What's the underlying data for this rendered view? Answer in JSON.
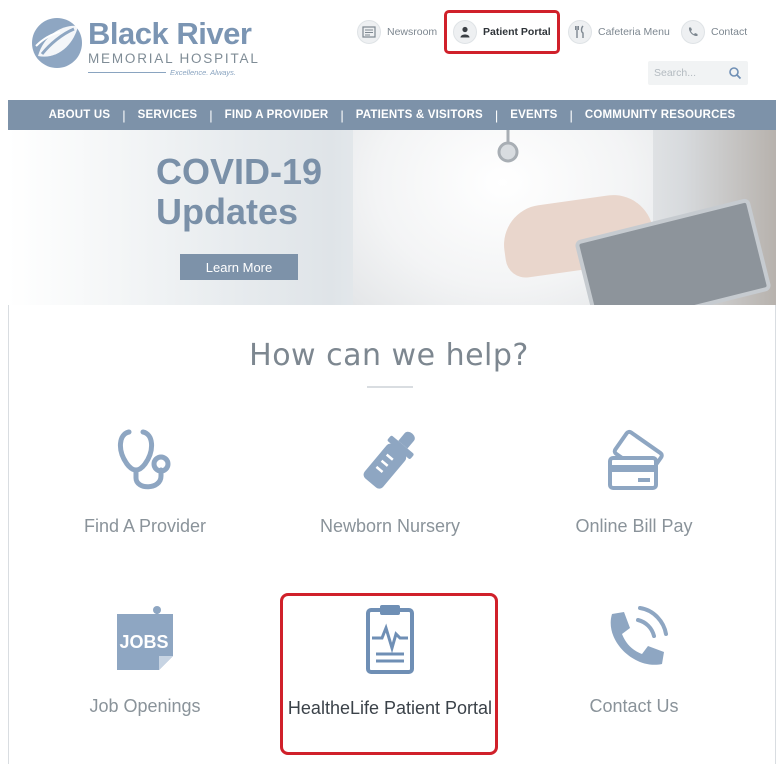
{
  "brand": {
    "name": "Black River",
    "subtitle": "MEMORIAL HOSPITAL",
    "tagline": "Excellence. Always."
  },
  "utility_links": [
    {
      "label": "Newsroom",
      "icon": "newspaper-icon"
    },
    {
      "label": "Patient Portal",
      "icon": "person-icon"
    },
    {
      "label": "Cafeteria Menu",
      "icon": "fork-knife-icon"
    },
    {
      "label": "Contact",
      "icon": "phone-icon"
    }
  ],
  "search": {
    "placeholder": "Search..."
  },
  "nav": {
    "items": [
      "ABOUT US",
      "SERVICES",
      "FIND A PROVIDER",
      "PATIENTS & VISITORS",
      "EVENTS",
      "COMMUNITY RESOURCES"
    ],
    "separator": "|"
  },
  "hero": {
    "title_line1": "COVID-19",
    "title_line2": "Updates",
    "button_label": "Learn More"
  },
  "help": {
    "title": "How can we help?",
    "tiles": [
      {
        "label": "Find A Provider",
        "icon": "stethoscope-icon"
      },
      {
        "label": "Newborn Nursery",
        "icon": "baby-bottle-icon"
      },
      {
        "label": "Online Bill Pay",
        "icon": "credit-card-icon"
      },
      {
        "label": "Job Openings",
        "icon": "jobs-note-icon",
        "icon_text": "JOBS"
      },
      {
        "label": "HealtheLife Patient Portal",
        "icon": "clipboard-heartbeat-icon"
      },
      {
        "label": "Contact Us",
        "icon": "phone-ringing-icon"
      }
    ]
  },
  "colors": {
    "brand_blue": "#7d92a9",
    "highlight_red": "#d0202a",
    "icon_blue": "#8ea6c2"
  }
}
